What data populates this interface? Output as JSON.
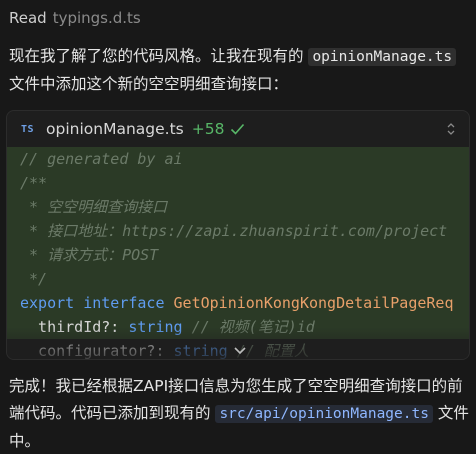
{
  "read": {
    "verb": "Read",
    "file": "typings.d.ts"
  },
  "message1": {
    "before": "现在我了解了您的代码风格。让我在现有的 ",
    "code": "opinionManage.ts",
    "after": " 文件中添加这个新的空空明细查询接口："
  },
  "code_card": {
    "filename": "opinionManage.ts",
    "lines_added": "+58",
    "lang_badge": "TS",
    "lines": {
      "l1": "// generated by ai",
      "l2": "/**",
      "l3": " * 空空明细查询接口",
      "l4": " * 接口地址：https://zapi.zhuanspirit.com/project",
      "l5": " * 请求方式：POST",
      "l6": " */",
      "l7_kw": "export interface ",
      "l7_name": "GetOpinionKongKongDetailPageReq",
      "l8_prop": "  thirdId?: ",
      "l8_type": "string",
      "l8_cmt": " // 视频(笔记)id",
      "l9_prop": "  configurator?: ",
      "l9_type": "string",
      "l9_cmt": " // 配置人"
    }
  },
  "message2": {
    "before": "完成！我已经根据ZAPI接口信息为您生成了空空明细查询接口的前端代码。代码已添加到现有的 ",
    "code": "src/api/opinionManage.ts",
    "after": " 文件中。"
  },
  "colors": {
    "background": "#181818",
    "added_line": "#2b3a26",
    "added_count": "#58b768",
    "keyword": "#5f9cf0",
    "type_name": "#e8a06a"
  },
  "icons": [
    "check-icon",
    "expand-collapse-icon",
    "chevron-down-icon"
  ]
}
